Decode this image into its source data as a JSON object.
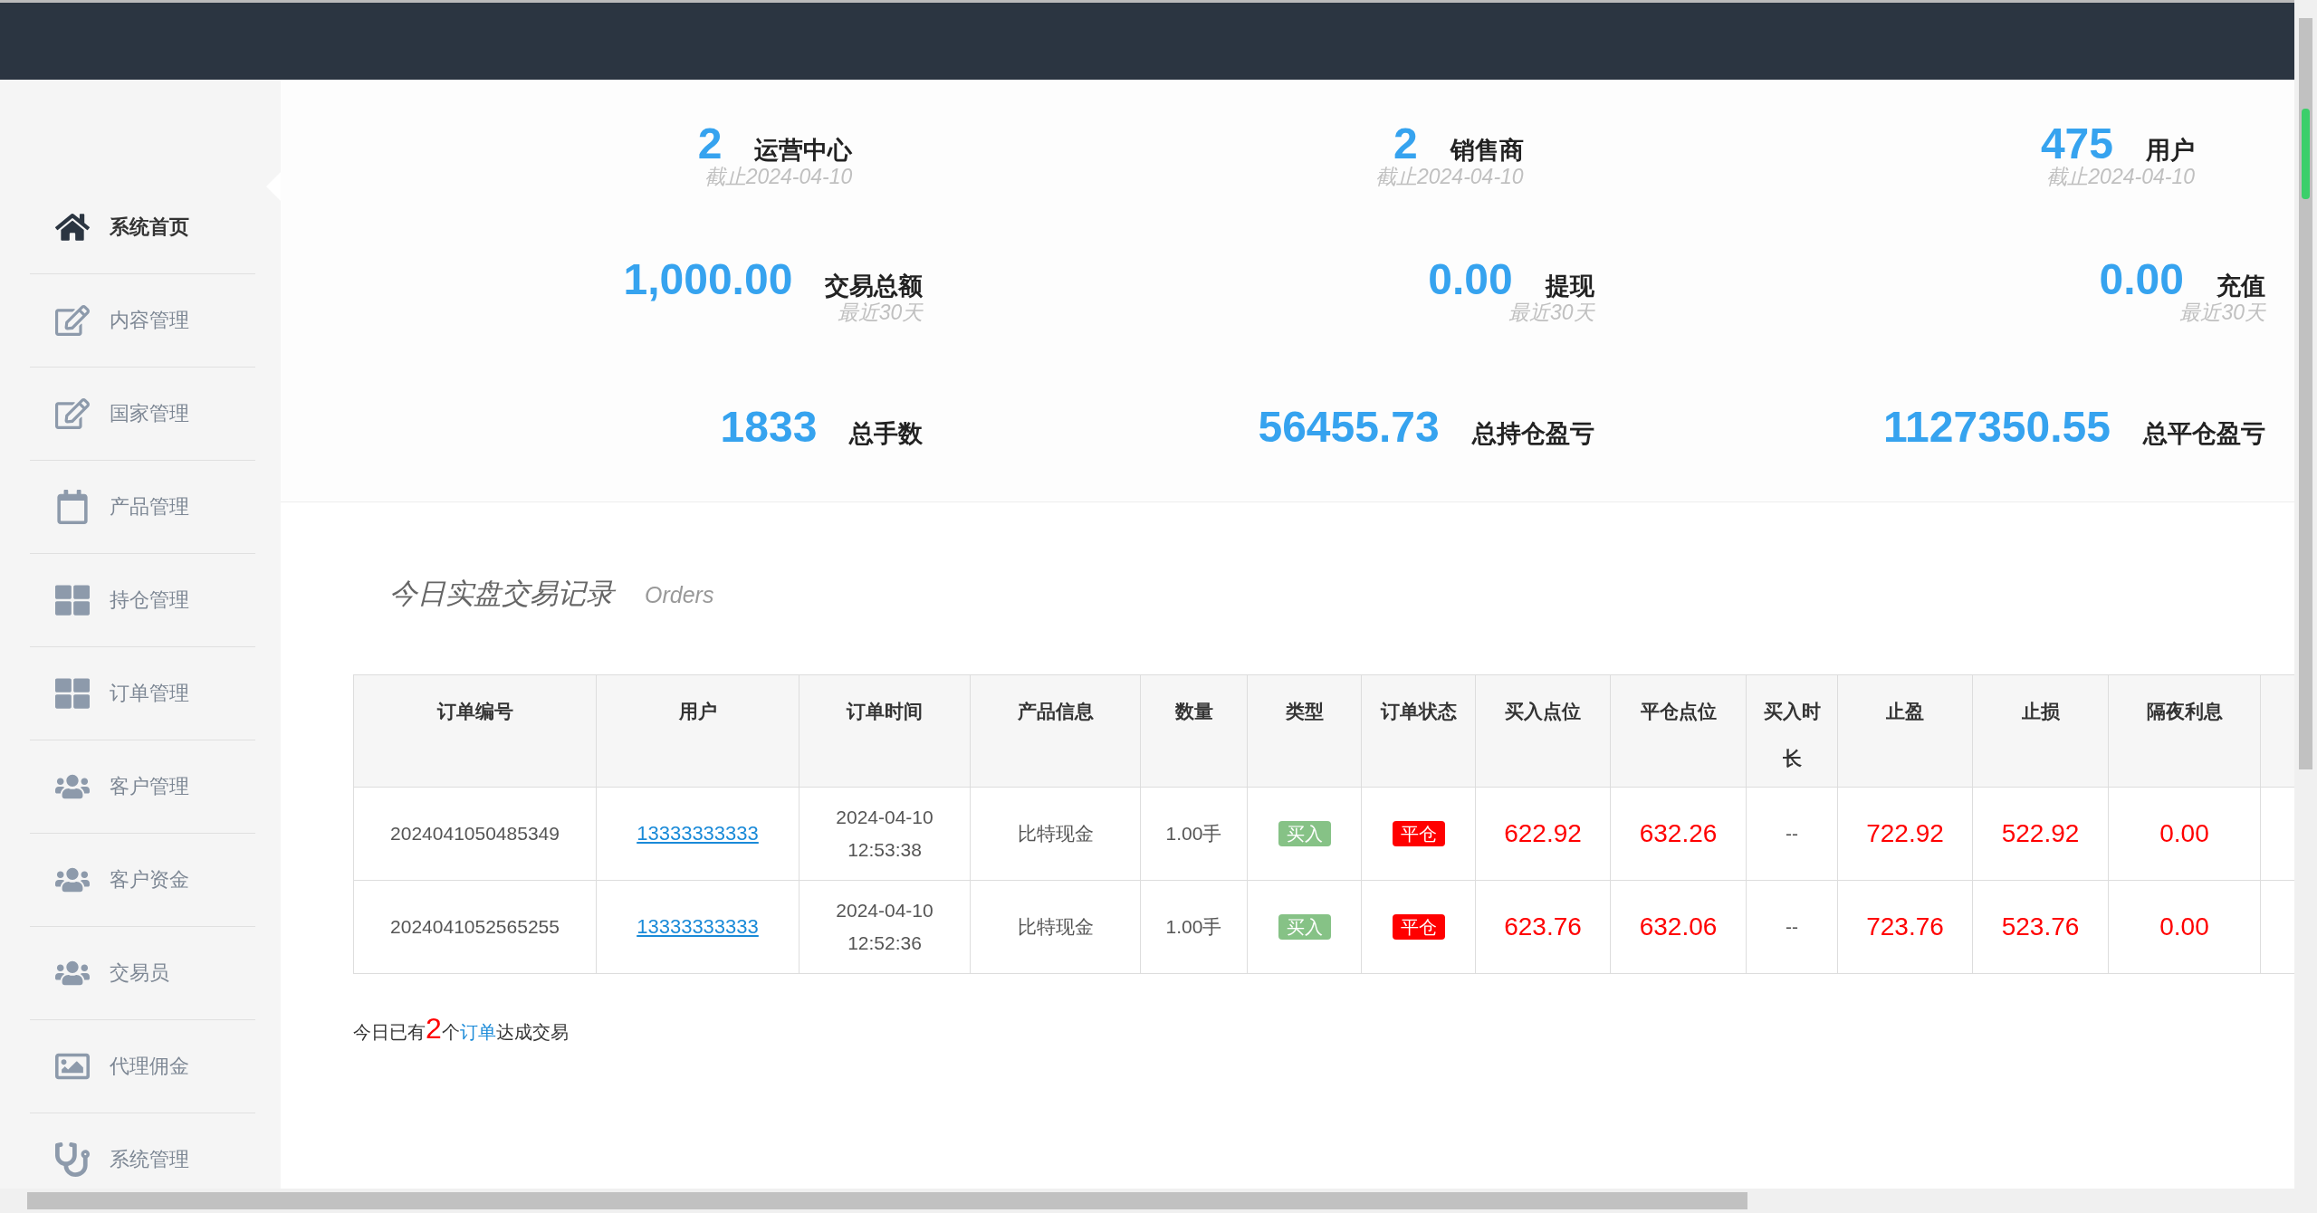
{
  "sidebar": {
    "items": [
      {
        "label": "系统首页",
        "kind": "home",
        "selected": true
      },
      {
        "label": "内容管理",
        "kind": "edit",
        "selected": false
      },
      {
        "label": "国家管理",
        "kind": "edit",
        "selected": false
      },
      {
        "label": "产品管理",
        "kind": "calendar",
        "selected": false
      },
      {
        "label": "持仓管理",
        "kind": "grid",
        "selected": false
      },
      {
        "label": "订单管理",
        "kind": "grid",
        "selected": false
      },
      {
        "label": "客户管理",
        "kind": "users",
        "selected": false
      },
      {
        "label": "客户资金",
        "kind": "users",
        "selected": false
      },
      {
        "label": "交易员",
        "kind": "users",
        "selected": false
      },
      {
        "label": "代理佣金",
        "kind": "image",
        "selected": false
      },
      {
        "label": "系统管理",
        "kind": "tool",
        "selected": false
      }
    ]
  },
  "stats": [
    [
      {
        "value": "2",
        "label": "运营中心",
        "note": "截止2024-04-10"
      },
      {
        "value": "2",
        "label": "销售商",
        "note": "截止2024-04-10"
      },
      {
        "value": "475",
        "label": "用户",
        "note": "截止2024-04-10"
      }
    ],
    [
      {
        "value": "1,000.00",
        "label": "交易总额",
        "note": "最近30天"
      },
      {
        "value": "0.00",
        "label": "提现",
        "note": "最近30天"
      },
      {
        "value": "0.00",
        "label": "充值",
        "note": "最近30天"
      }
    ],
    [
      {
        "value": "1833",
        "label": "总手数"
      },
      {
        "value": "56455.73",
        "label": "总持仓盈亏"
      },
      {
        "value": "1127350.55",
        "label": "总平仓盈亏"
      }
    ]
  ],
  "orders": {
    "title": "今日实盘交易记录",
    "subtitle": "Orders",
    "columns": [
      "订单编号",
      "用户",
      "订单时间",
      "产品信息",
      "数量",
      "类型",
      "订单状态",
      "买入点位",
      "平仓点位",
      "买入时长",
      "止盈",
      "止损",
      "隔夜利息"
    ],
    "rows": [
      {
        "order_no": "2024041050485349",
        "user": "13333333333",
        "time": "2024-04-10\n12:53:38",
        "product": "比特现金",
        "quantity": "1.00手",
        "type": "买入",
        "status": "平仓",
        "buy_price": "622.92",
        "close_price": "632.26",
        "duration": "--",
        "take_profit": "722.92",
        "stop_loss": "522.92",
        "overnight_interest": "0.00"
      },
      {
        "order_no": "2024041052565255",
        "user": "13333333333",
        "time": "2024-04-10\n12:52:36",
        "product": "比特现金",
        "quantity": "1.00手",
        "type": "买入",
        "status": "平仓",
        "buy_price": "623.76",
        "close_price": "632.06",
        "duration": "--",
        "take_profit": "723.76",
        "stop_loss": "523.76",
        "overnight_interest": "0.00"
      }
    ],
    "summary": {
      "before": "今日已有",
      "count": "2",
      "middle": "个",
      "link": "订单",
      "after": "达成交易"
    }
  }
}
